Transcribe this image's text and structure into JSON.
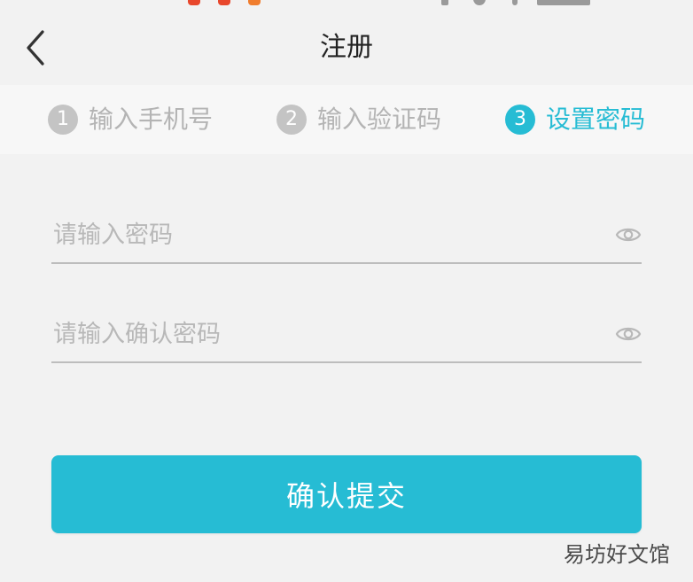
{
  "colors": {
    "accent": "#26bcd4",
    "inactive_step_circle": "#c4c4c4",
    "inactive_step_text": "#b4b4b4",
    "background": "#f2f2f2",
    "status_dot_red": "#e8472c",
    "status_dot_orange": "#f07d2e"
  },
  "header": {
    "back_icon": "chevron-left-icon",
    "title": "注册"
  },
  "steps": [
    {
      "number": "1",
      "label": "输入手机号"
    },
    {
      "number": "2",
      "label": "输入验证码"
    },
    {
      "number": "3",
      "label": "设置密码"
    }
  ],
  "active_step": 3,
  "form": {
    "password": {
      "value": "",
      "placeholder": "请输入密码",
      "toggle_icon": "eye-icon"
    },
    "confirm_password": {
      "value": "",
      "placeholder": "请输入确认密码",
      "toggle_icon": "eye-icon"
    },
    "submit_label": "确认提交"
  },
  "watermark": "易坊好文馆"
}
